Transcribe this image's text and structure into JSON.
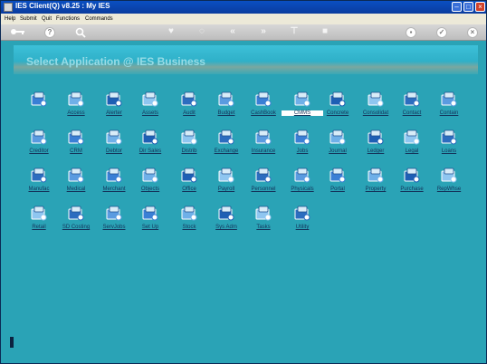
{
  "window": {
    "title": "IES Client(Q) v8.25 : My IES"
  },
  "menu": {
    "items": [
      "Help",
      "Submit",
      "Quit",
      "Functions",
      "Commands"
    ]
  },
  "toolbar": {
    "icons": [
      "key-icon",
      "help-icon",
      "search-icon",
      "heart-icon",
      "power-icon",
      "rewind-icon",
      "forward-icon",
      "filter-icon",
      "stop-icon",
      "printer-icon",
      "check-icon",
      "close-icon"
    ]
  },
  "banner": {
    "title": "Select Application @ IES Business"
  },
  "apps": [
    [
      "",
      "Access",
      "Alerter",
      "Assets",
      "Audit",
      "Budget",
      "CashBook",
      "CMMS",
      "Concrete",
      "Consolidat",
      "Contact",
      "Contain"
    ],
    [
      "Creditor",
      "CRM",
      "Debtor",
      "Dir Sales",
      "Distrib",
      "Exchange",
      "Insurance",
      "Jobs",
      "Journal",
      "Ledger",
      "Legal",
      "Loans"
    ],
    [
      "Manufac",
      "Medical",
      "Merchant",
      "Objects",
      "Office",
      "Payroll",
      "Personnel",
      "Physicals",
      "Portal",
      "Property",
      "Purchase",
      "RepWhse"
    ],
    [
      "Retail",
      "SD Costing",
      "ServJobs",
      "Set Up",
      "Stock",
      "Sys Adm",
      "Tasks",
      "Utility"
    ]
  ],
  "selected_app": "CMMS",
  "colors": {
    "background": "#2aa3b6",
    "titlebar": "#0a4fc2",
    "banner_text": "#97dce6",
    "label": "#14335a"
  }
}
